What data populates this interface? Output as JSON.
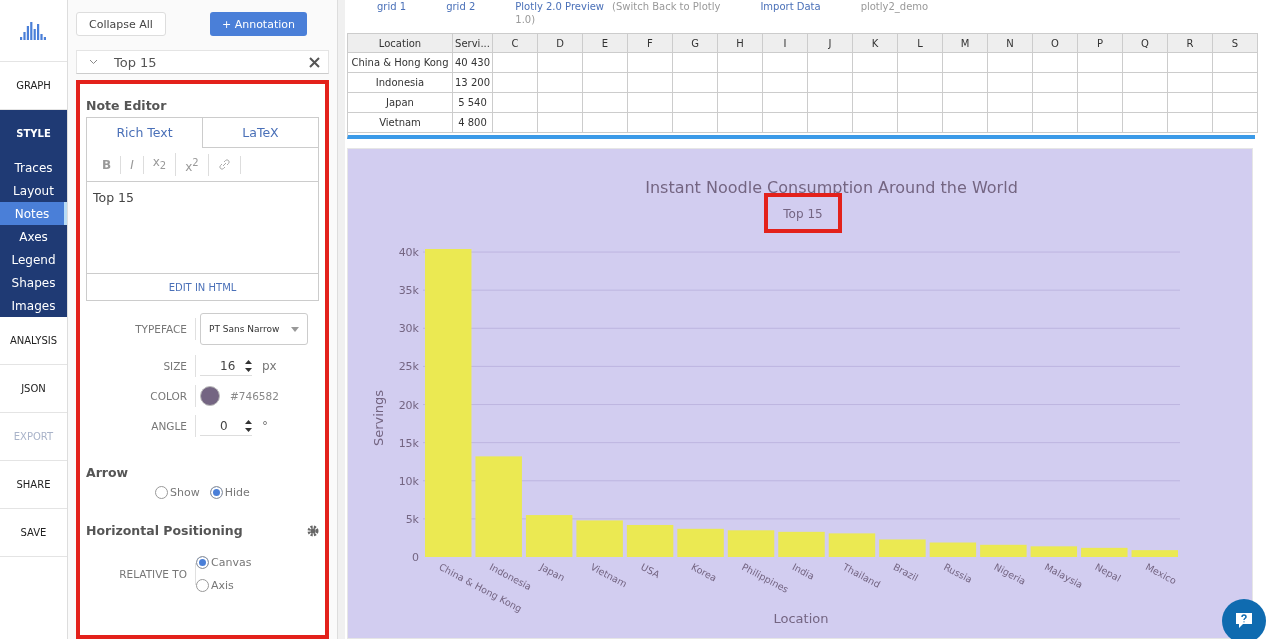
{
  "nav": {
    "items": [
      {
        "label": "GRAPH",
        "kind": "main",
        "selected": false,
        "disabled": false
      },
      {
        "label": "STYLE",
        "kind": "section",
        "selected": false,
        "disabled": false
      },
      {
        "label": "Traces",
        "kind": "sub",
        "selected": false,
        "disabled": false
      },
      {
        "label": "Layout",
        "kind": "sub",
        "selected": false,
        "disabled": false
      },
      {
        "label": "Notes",
        "kind": "sub",
        "selected": true,
        "disabled": false
      },
      {
        "label": "Axes",
        "kind": "sub",
        "selected": false,
        "disabled": false
      },
      {
        "label": "Legend",
        "kind": "sub",
        "selected": false,
        "disabled": false
      },
      {
        "label": "Shapes",
        "kind": "sub",
        "selected": false,
        "disabled": false
      },
      {
        "label": "Images",
        "kind": "sub",
        "selected": false,
        "disabled": false
      },
      {
        "label": "ANALYSIS",
        "kind": "main",
        "selected": false,
        "disabled": false
      },
      {
        "label": "JSON",
        "kind": "main",
        "selected": false,
        "disabled": false
      },
      {
        "label": "EXPORT",
        "kind": "main",
        "selected": false,
        "disabled": true
      },
      {
        "label": "SHARE",
        "kind": "main",
        "selected": false,
        "disabled": false
      },
      {
        "label": "SAVE",
        "kind": "main",
        "selected": false,
        "disabled": false
      }
    ]
  },
  "panel": {
    "collapse_button": "Collapse All",
    "add_button": "+ Annotation",
    "annotation": {
      "title": "Top 15",
      "expanded": true
    },
    "note_editor": {
      "title": "Note Editor",
      "tabs": [
        {
          "label": "Rich Text",
          "selected": true
        },
        {
          "label": "LaTeX",
          "selected": false
        }
      ],
      "toolbar": [
        {
          "kind": "bold",
          "label": "B"
        },
        {
          "kind": "italic",
          "label": "I"
        },
        {
          "kind": "text",
          "label": "x$_{2}$"
        },
        {
          "kind": "text",
          "label": "x$^{2}$"
        },
        {
          "kind": "link"
        }
      ],
      "content": "Top 15",
      "html_link": "EDIT IN HTML"
    },
    "fields": [
      {
        "kind": "select",
        "label": "TYPEFACE",
        "value": "PT Sans Narrow"
      },
      {
        "kind": "number",
        "label": "SIZE",
        "value": "16",
        "unit": "px"
      },
      {
        "kind": "color",
        "label": "COLOR",
        "value": "#746582"
      },
      {
        "kind": "number",
        "label": "ANGLE",
        "value": "0",
        "unit": "°"
      }
    ],
    "arrow": {
      "title": "Arrow",
      "options": [
        {
          "label": "Show",
          "selected": false
        },
        {
          "label": "Hide",
          "selected": true
        }
      ]
    },
    "horizontal": {
      "title": "Horizontal Positioning",
      "label": "RELATIVE TO",
      "options": [
        {
          "label": "Canvas",
          "selected": true
        },
        {
          "label": "Axis",
          "selected": false
        }
      ]
    }
  },
  "top_bar": {
    "tabs": [
      "grid 1",
      "grid 2"
    ],
    "preview": "Plotly 2.0 Preview",
    "switch_back": "(Switch Back to Plotly",
    "switch_back_2": "1.0)",
    "import": "Import Data",
    "file": "plotly2_demo"
  },
  "grid": {
    "columns": [
      "Location",
      "Servi...",
      "C",
      "D",
      "E",
      "F",
      "G",
      "H",
      "I",
      "J",
      "K",
      "L",
      "M",
      "N",
      "O",
      "P",
      "Q",
      "R",
      "S"
    ],
    "rows": [
      [
        "China & Hong Kong",
        "40 430"
      ],
      [
        "Indonesia",
        "13 200"
      ],
      [
        "Japan",
        "5 540"
      ],
      [
        "Vietnam",
        "4 800"
      ]
    ]
  },
  "chart": {
    "annotation": "Top 15",
    "chart_data": {
      "type": "bar",
      "title": "Instant Noodle Consumption Around the World",
      "xlabel": "Location",
      "ylabel": "Servings",
      "categories": [
        "China & Hong Kong",
        "Indonesia",
        "Japan",
        "Vietnam",
        "USA",
        "Korea",
        "Philippines",
        "India",
        "Thailand",
        "Brazil",
        "Russia",
        "Nigeria",
        "Malaysia",
        "Nepal",
        "Mexico"
      ],
      "values": [
        40400,
        13200,
        5500,
        4800,
        4200,
        3700,
        3500,
        3300,
        3100,
        2300,
        1900,
        1600,
        1400,
        1200,
        900
      ],
      "ylim": [
        0,
        40400
      ],
      "grid": true,
      "yticks": [
        {
          "value": 0,
          "label": "0"
        },
        {
          "value": 5000,
          "label": "5k"
        },
        {
          "value": 10000,
          "label": "10k"
        },
        {
          "value": 15000,
          "label": "15k"
        },
        {
          "value": 20000,
          "label": "20k"
        },
        {
          "value": 25000,
          "label": "25k"
        },
        {
          "value": 30000,
          "label": "30k"
        },
        {
          "value": 35000,
          "label": "35k"
        },
        {
          "value": 40000,
          "label": "40k"
        }
      ]
    }
  }
}
